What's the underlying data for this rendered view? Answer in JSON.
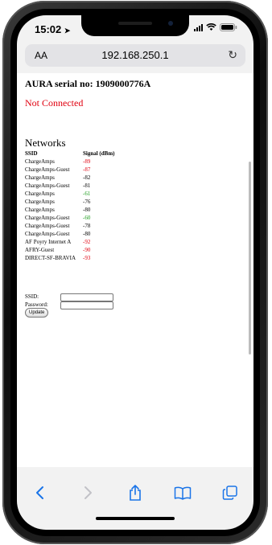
{
  "status": {
    "time": "15:02"
  },
  "browser": {
    "text_size_label": "AA",
    "url": "192.168.250.1",
    "reload_symbol": "↻"
  },
  "page": {
    "serial_heading": "AURA serial no: 1909000776A",
    "connection_status": "Not Connected",
    "networks_title": "Networks",
    "table_headers": {
      "ssid": "SSID",
      "signal": "Signal (dBm)"
    },
    "networks": [
      {
        "ssid": "ChargeAmps",
        "signal": "-89",
        "color": "#e0000f"
      },
      {
        "ssid": "ChargeAmps-Guest",
        "signal": "-87",
        "color": "#e0000f"
      },
      {
        "ssid": "ChargeAmps",
        "signal": "-82",
        "color": "#000000"
      },
      {
        "ssid": "ChargeAmps-Guest",
        "signal": "-81",
        "color": "#000000"
      },
      {
        "ssid": "ChargeAmps",
        "signal": "-61",
        "color": "#1a9b1a"
      },
      {
        "ssid": "ChargeAmps",
        "signal": "-76",
        "color": "#000000"
      },
      {
        "ssid": "ChargeAmps",
        "signal": "-80",
        "color": "#000000"
      },
      {
        "ssid": "ChargeAmps-Guest",
        "signal": "-60",
        "color": "#1a9b1a"
      },
      {
        "ssid": "ChargeAmps-Guest",
        "signal": "-78",
        "color": "#000000"
      },
      {
        "ssid": "ChargeAmps-Guest",
        "signal": "-80",
        "color": "#000000"
      },
      {
        "ssid": "AF Poyry Internet A",
        "signal": "-92",
        "color": "#e0000f"
      },
      {
        "ssid": "AFRY-Guest",
        "signal": "-90",
        "color": "#e0000f"
      },
      {
        "ssid": "DIRECT-SF-BRAVIA",
        "signal": "-93",
        "color": "#e0000f"
      }
    ],
    "ssid_label": "SSID:",
    "password_label": "Password:",
    "update_button": "Update"
  },
  "toolbar": {
    "back": "back-icon",
    "forward": "forward-icon",
    "share": "share-icon",
    "bookmarks": "bookmarks-icon",
    "tabs": "tabs-icon"
  },
  "colors": {
    "red_status": "#e0000f",
    "green_signal": "#1a9b1a",
    "ios_blue": "#1a74e8"
  }
}
